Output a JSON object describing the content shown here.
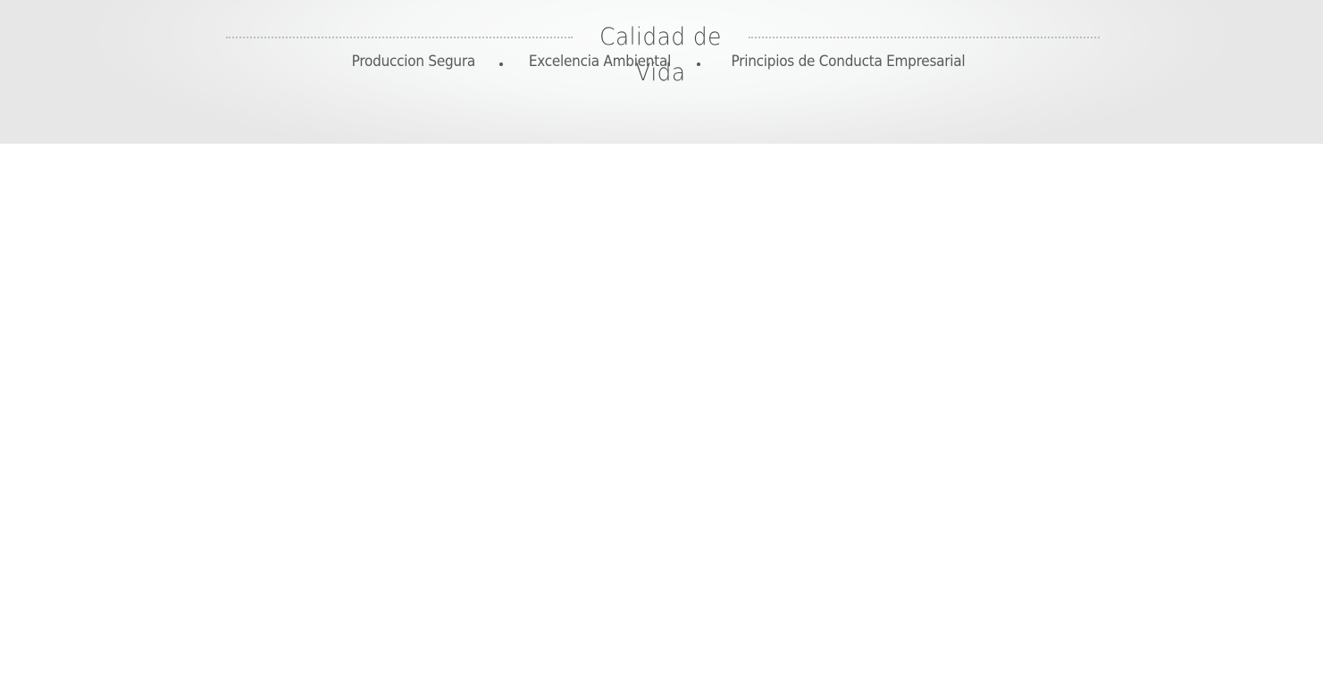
{
  "header": {
    "title": "Calidad de Vida",
    "nav": [
      {
        "label": "Produccion Segura"
      },
      {
        "label": "Excelencia Ambiental"
      },
      {
        "label": "Principios de Conducta Empresarial"
      }
    ]
  },
  "colors": {
    "text": "#57595b",
    "title": "#4a4d4f",
    "dotted_rule": "#b9bfc0",
    "band": "#ececec",
    "page": "#ffffff"
  }
}
